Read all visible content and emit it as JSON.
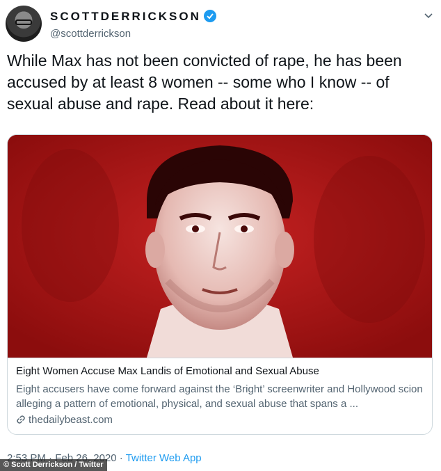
{
  "user": {
    "display_name": "SCOTTDERRICKSON",
    "handle": "@scottderrickson"
  },
  "tweet": {
    "text": "While Max has not been convicted of rape, he has been accused by at least 8 women -- some who I know -- of sexual abuse and rape. Read about it here:"
  },
  "card": {
    "title": "Eight Women Accuse Max Landis of Emotional and Sexual Abuse",
    "description": "Eight accusers have come forward against the ‘Bright’ screenwriter and Hollywood scion alleging a pattern of emotional, physical, and sexual abuse that spans a ...",
    "domain": "thedailybeast.com",
    "image_tint": "#b01818"
  },
  "meta": {
    "time": "2:53 PM",
    "separator": "·",
    "date": "Feb 26, 2020",
    "source": "Twitter Web App"
  },
  "photo_credit": "© Scott Derrickson / Twitter",
  "colors": {
    "verified": "#1d9bf0",
    "link": "#1d9bf0",
    "secondary_text": "#536471",
    "card_border": "#cfd9de"
  },
  "icons": [
    "verified-badge-icon",
    "chevron-down-icon",
    "link-icon"
  ]
}
